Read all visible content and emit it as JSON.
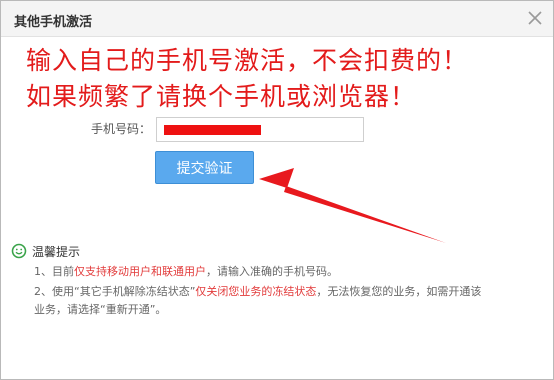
{
  "dialog": {
    "title": "其他手机激活",
    "close_icon": "close-icon"
  },
  "banner": {
    "line1": "输入自己的手机号激活，不会扣费的！",
    "line2": "如果频繁了请换个手机或浏览器！"
  },
  "form": {
    "phone_label": "手机号码：",
    "phone_value": "",
    "submit_label": "提交验证"
  },
  "tips": {
    "title": "温馨提示",
    "icon": "smile-icon",
    "item1": {
      "a": "1、目前",
      "highlight": "仅支持移动用户和联通用户",
      "b": "，请输入准确的手机号码。"
    },
    "item2": {
      "a": "2、使用“其它手机解除冻结状态”",
      "highlight": "仅关闭您业务的冻结状态",
      "b": "，无法恢复您的业务，如需开通该",
      "c": "业务，请选择“重新开通”。"
    }
  },
  "colors": {
    "banner_red": "#e31b1b",
    "button_blue": "#5aa9ee",
    "highlight_red": "#e23b3b",
    "smile_green": "#3aa34a"
  }
}
